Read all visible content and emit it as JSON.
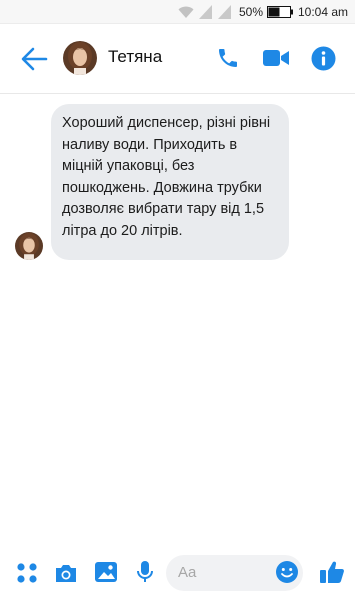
{
  "status_bar": {
    "battery_percent": "50%",
    "time": "10:04 am"
  },
  "header": {
    "contact_name": "Тетяна"
  },
  "conversation": {
    "messages": [
      {
        "text": "Хороший диспенсер, різні рівні наливу води. Приходить в міцній упаковці, без пошкоджень. Довжина трубки дозволяє вибрати тару від 1,5 літра до 20 літрів."
      }
    ]
  },
  "composer": {
    "placeholder": "Aa"
  },
  "colors": {
    "accent": "#1e88e5",
    "bubble_bg": "#e9ebee",
    "input_bg": "#f1f2f4"
  },
  "icons": [
    "wifi-icon",
    "signal-icon",
    "battery-icon",
    "back-arrow-icon",
    "phone-icon",
    "video-camera-icon",
    "info-icon",
    "apps-icon",
    "camera-icon",
    "gallery-icon",
    "microphone-icon",
    "emoji-icon",
    "thumbs-up-icon"
  ]
}
